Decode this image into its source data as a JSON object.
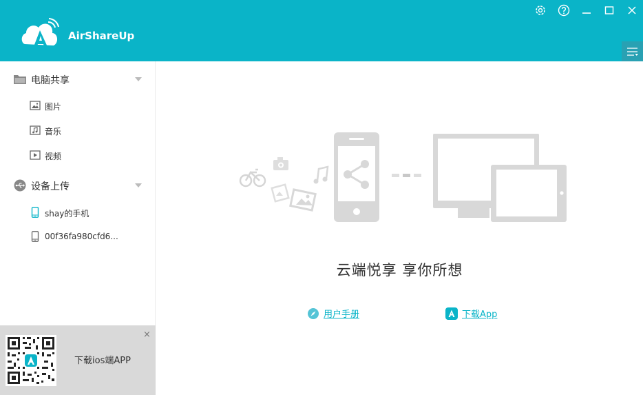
{
  "app": {
    "title": "AirShareUp"
  },
  "colors": {
    "brand": "#0ab4c8",
    "brand_dark": "#29a1b3",
    "illustration": "#d8d8d8"
  },
  "window_controls": [
    {
      "name": "settings",
      "icon": "gear-icon"
    },
    {
      "name": "help",
      "icon": "help-icon"
    },
    {
      "name": "minimize",
      "icon": "minimize-icon"
    },
    {
      "name": "maximize",
      "icon": "maximize-icon"
    },
    {
      "name": "close",
      "icon": "close-icon"
    }
  ],
  "sidebar": {
    "pc_share": {
      "label": "电脑共享",
      "items": [
        {
          "label": "图片",
          "icon": "image-icon"
        },
        {
          "label": "音乐",
          "icon": "music-icon"
        },
        {
          "label": "视频",
          "icon": "video-icon"
        }
      ]
    },
    "device_upload": {
      "label": "设备上传",
      "items": [
        {
          "label": "shay的手机",
          "icon": "phone-icon"
        },
        {
          "label": "00f36fa980cfd6...",
          "icon": "phone-icon"
        }
      ]
    }
  },
  "promo": {
    "text": "下载ios端APP",
    "close": "×"
  },
  "main": {
    "slogan": "云端悦享 享你所想",
    "links": {
      "manual": "用户手册",
      "download": "下载App"
    }
  }
}
